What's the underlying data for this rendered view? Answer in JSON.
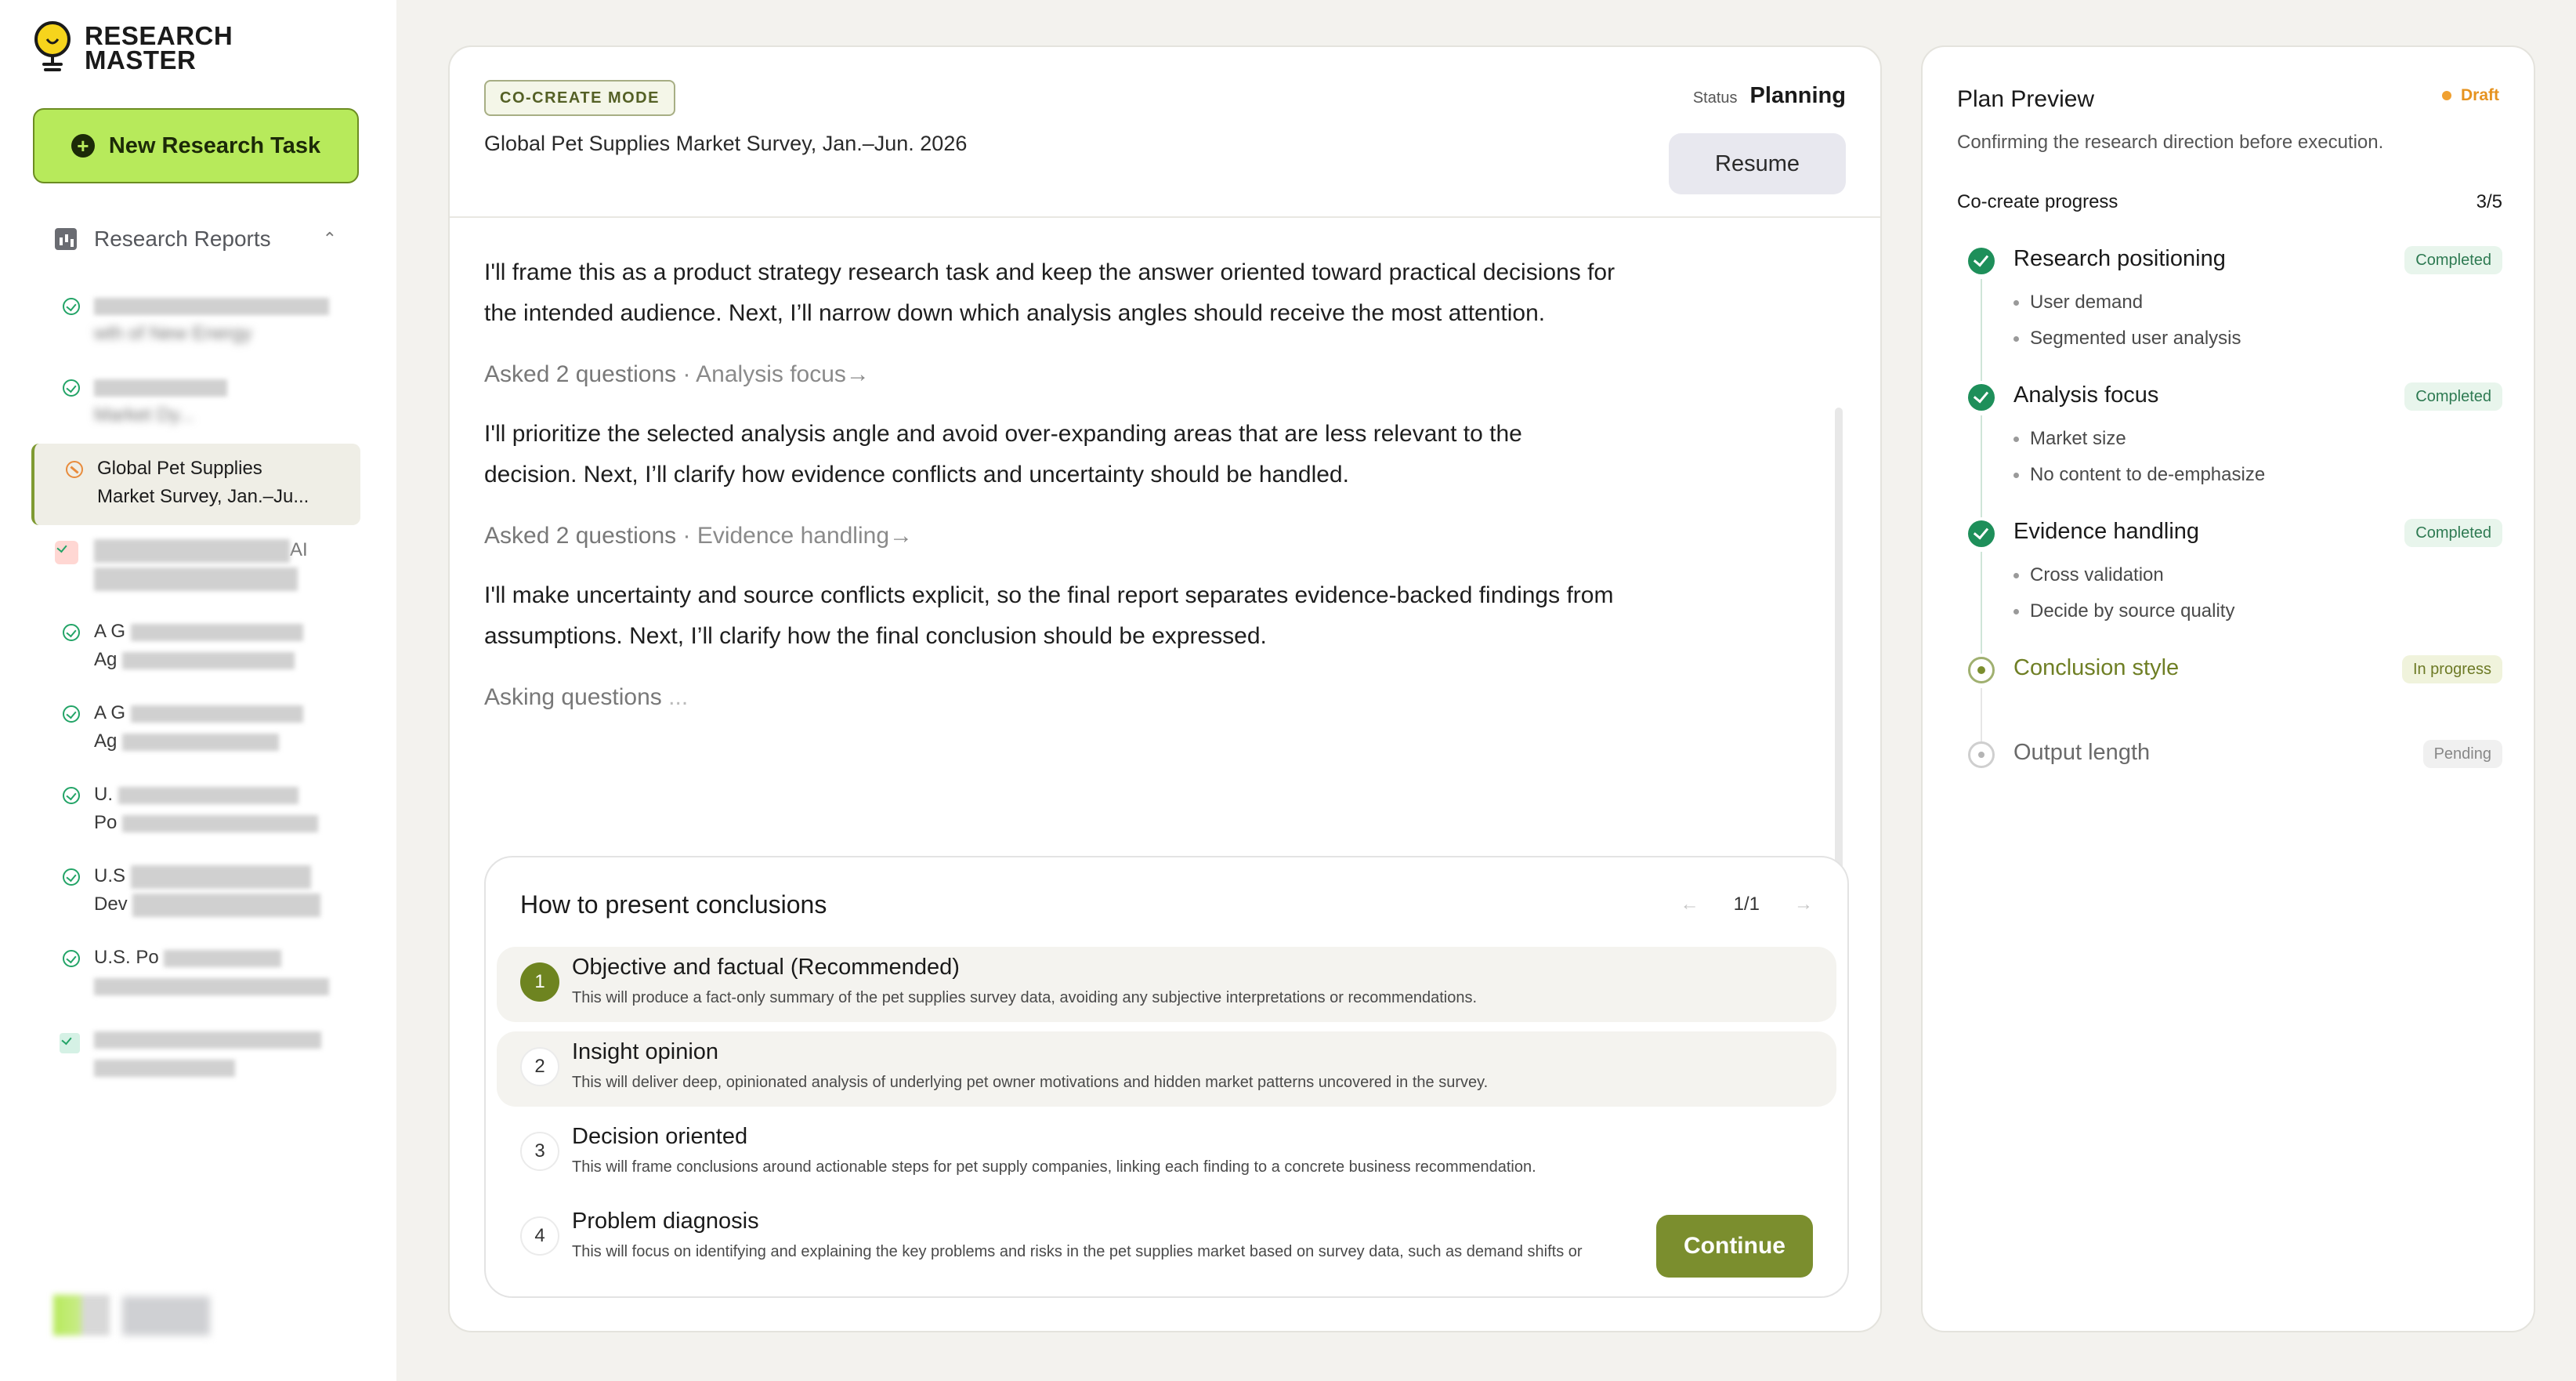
{
  "app": {
    "name_line1": "RESEARCH",
    "name_line2": "MASTER"
  },
  "sidebar": {
    "new_task_label": "New Research Task",
    "section_label": "Research Reports",
    "tasks": [
      {
        "line1": "",
        "line2": "wth of New Energy",
        "state": "done"
      },
      {
        "line1": "",
        "line2": "Market Dy...",
        "state": "done"
      },
      {
        "line1": "Global Pet Supplies",
        "line2": "Market Survey, Jan.–Ju...",
        "state": "active"
      },
      {
        "line1": "AI",
        "line2": "",
        "state": "pending"
      },
      {
        "line1": "A G",
        "line2": "Ag",
        "state": "done"
      },
      {
        "line1": "A G",
        "line2": "Ag",
        "state": "done"
      },
      {
        "line1": "U.",
        "line2": "Po",
        "state": "done"
      },
      {
        "line1": "U.S",
        "line2": "Dev",
        "state": "done"
      },
      {
        "line1": "U.S. Po",
        "line2": "",
        "state": "done"
      },
      {
        "line1": "",
        "line2": "",
        "state": "mint"
      }
    ]
  },
  "main": {
    "badge": "CO-CREATE MODE",
    "title": "Global Pet Supplies Market Survey, Jan.–Jun. 2026",
    "status_label": "Status",
    "status_value": "Planning",
    "resume_label": "Resume",
    "para1": "I'll frame this as a product strategy research task and keep the answer oriented toward practical decisions for the intended audience. Next, I’ll narrow down which analysis angles should receive the most attention.",
    "ask1": "Asked 2 questions",
    "ask1_sub": "· Analysis focus",
    "para2": "I'll prioritize the selected analysis angle and avoid over-expanding areas that are less relevant to the decision. Next, I’ll clarify how evidence conflicts and uncertainty should be handled.",
    "ask2": "Asked 2 questions",
    "ask2_sub": "· Evidence handling",
    "para3": "I'll make uncertainty and source conflicts explicit, so the final report separates evidence-backed findings from assumptions. Next, I’ll clarify how the final conclusion should be expressed.",
    "asking": "Asking questions",
    "question": {
      "title": "How to present conclusions",
      "pager": "1/1",
      "options": [
        {
          "num": "1",
          "title": "Objective and factual (Recommended)",
          "desc": "This will produce a fact-only summary of the pet supplies survey data, avoiding any subjective interpretations or recommendations."
        },
        {
          "num": "2",
          "title": "Insight opinion",
          "desc": "This will deliver deep, opinionated analysis of underlying pet owner motivations and hidden market patterns uncovered in the survey."
        },
        {
          "num": "3",
          "title": "Decision oriented",
          "desc": "This will frame conclusions around actionable steps for pet supply companies, linking each finding to a concrete business recommendation."
        },
        {
          "num": "4",
          "title": "Problem diagnosis",
          "desc": "This will focus on identifying and explaining the key problems and risks in the pet supplies market based on survey data, such as demand shifts or"
        }
      ],
      "continue_label": "Continue"
    }
  },
  "plan": {
    "title": "Plan Preview",
    "draft": "Draft",
    "subtitle": "Confirming the research direction before execution.",
    "progress_label": "Co-create progress",
    "progress_value": "3/5",
    "steps": [
      {
        "name": "Research positioning",
        "tag": "Completed",
        "bullets": [
          "User demand",
          "Segmented user analysis"
        ]
      },
      {
        "name": "Analysis focus",
        "tag": "Completed",
        "bullets": [
          "Market size",
          "No content to de-emphasize"
        ]
      },
      {
        "name": "Evidence handling",
        "tag": "Completed",
        "bullets": [
          "Cross validation",
          "Decide by source quality"
        ]
      },
      {
        "name": "Conclusion style",
        "tag": "In progress",
        "bullets": []
      },
      {
        "name": "Output length",
        "tag": "Pending",
        "bullets": []
      }
    ]
  },
  "colors": {
    "accent": "#b7ea5b",
    "olive": "#7b8e2e",
    "done": "#1e8f5a",
    "draft": "#f0a030"
  }
}
